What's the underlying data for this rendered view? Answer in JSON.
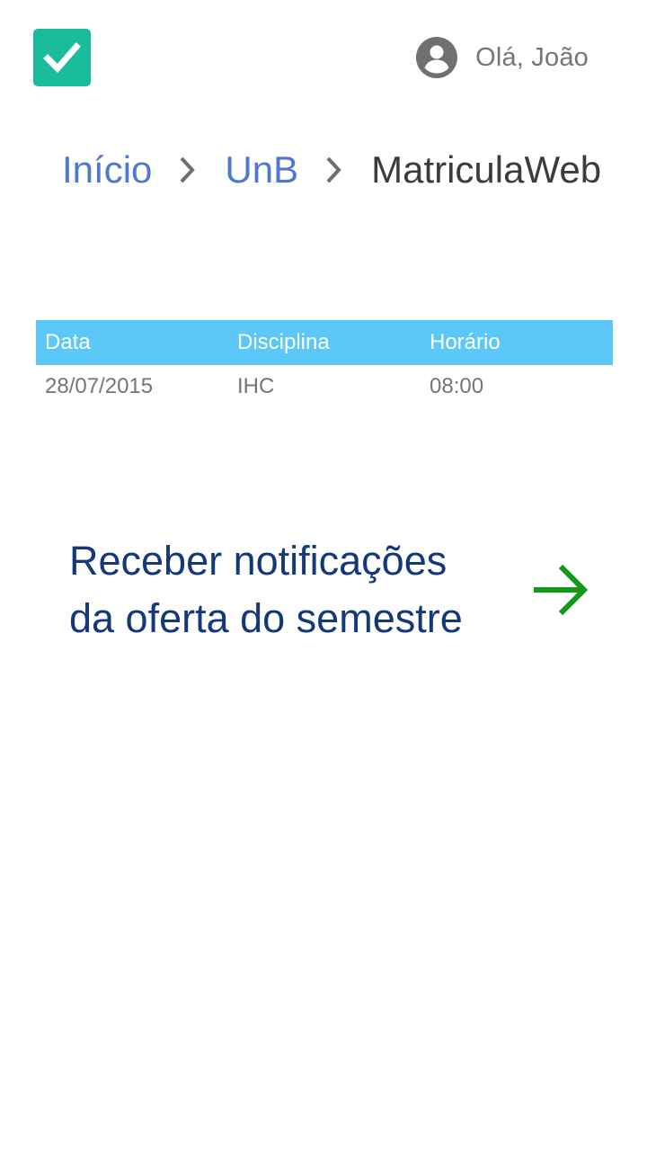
{
  "header": {
    "logo_icon": "check-icon",
    "logo_color": "#1abc9c",
    "user_icon": "account-circle-icon",
    "greeting": "Olá, João"
  },
  "breadcrumb": {
    "items": [
      {
        "label": "Início",
        "link": true
      },
      {
        "label": "UnB",
        "link": true
      },
      {
        "label": "MatriculaWeb",
        "link": false
      }
    ],
    "separator_icon": "chevron-right-icon",
    "link_color": "#4f78d4"
  },
  "table": {
    "header_color": "#5bc8f8",
    "columns": [
      "Data",
      "Disciplina",
      "Horário"
    ],
    "rows": [
      [
        "28/07/2015",
        "IHC",
        "08:00"
      ]
    ]
  },
  "notify": {
    "line1": "Receber notificações",
    "line2": "da oferta do semestre",
    "arrow_icon": "arrow-right-icon",
    "arrow_color": "#119a19",
    "text_color": "#14397a"
  }
}
